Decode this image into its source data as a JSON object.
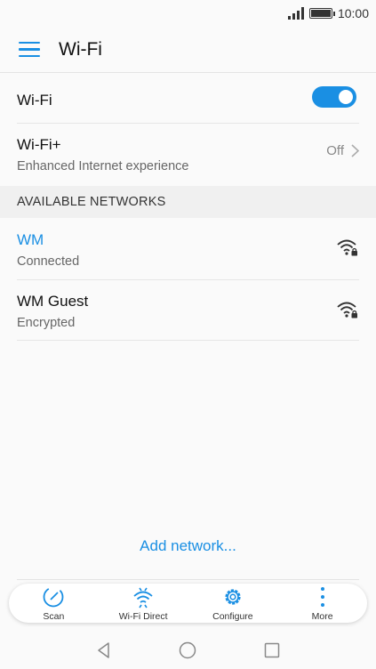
{
  "status": {
    "time": "10:00"
  },
  "header": {
    "title": "Wi-Fi"
  },
  "wifi_toggle": {
    "label": "Wi-Fi",
    "state": "on"
  },
  "wifi_plus": {
    "title": "Wi-Fi+",
    "subtitle": "Enhanced Internet experience",
    "value": "Off"
  },
  "section": {
    "title": "AVAILABLE NETWORKS"
  },
  "networks": [
    {
      "name": "WM",
      "status": "Connected",
      "color": "#1a8fe3"
    },
    {
      "name": "WM Guest",
      "status": "Encrypted",
      "color": "#111111"
    }
  ],
  "add_network": "Add network...",
  "bottom_actions": [
    {
      "label": "Scan",
      "icon": "scan-icon"
    },
    {
      "label": "Wi-Fi Direct",
      "icon": "wifi-direct-icon"
    },
    {
      "label": "Configure",
      "icon": "gear-icon"
    },
    {
      "label": "More",
      "icon": "more-icon"
    }
  ],
  "colors": {
    "accent": "#1a8fe3"
  }
}
